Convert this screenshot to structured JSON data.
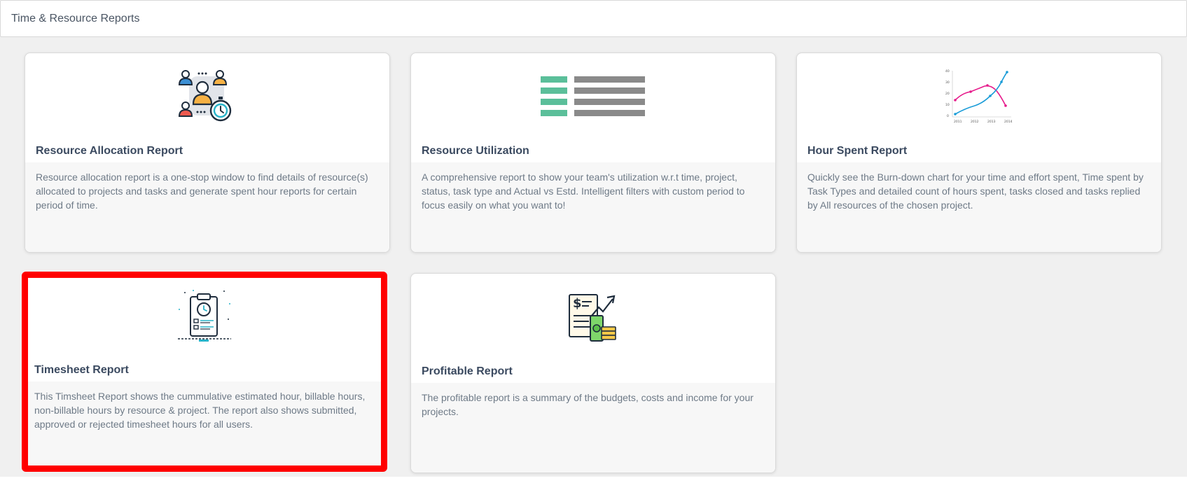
{
  "header": {
    "title": "Time & Resource Reports"
  },
  "colors": {
    "selection_border": "#ff0000",
    "background": "#f0f0f0"
  },
  "cards": [
    {
      "title": "Resource Allocation Report",
      "description": "Resource allocation report is a one-stop window to find details of resource(s) allocated to projects and tasks and generate spent hour reports for certain period of time.",
      "icon": "resource-allocation-icon"
    },
    {
      "title": "Resource Utilization",
      "description": "A comprehensive report to show your team's utilization w.r.t time, project, status, task type and Actual vs Estd. Intelligent filters with custom period to focus easily on what you want to!",
      "icon": "list-icon"
    },
    {
      "title": "Hour Spent Report",
      "description": "Quickly see the Burn-down chart for your time and effort spent, Time spent by Task Types and detailed count of hours spent, tasks closed and tasks replied by All resources of the chosen project.",
      "icon": "line-chart-icon",
      "icon_chart": {
        "y_ticks": [
          "40",
          "30",
          "20",
          "10",
          "0"
        ],
        "x_ticks": [
          "2011",
          "2012",
          "2013",
          "2014"
        ]
      }
    },
    {
      "title": "Timesheet Report",
      "description": "This Timsheet Report shows the cummulative estimated hour, billable hours, non-billable hours by resource & project. The report also shows submitted, approved or rejected timesheet hours for all users.",
      "icon": "timesheet-clipboard-icon",
      "selected": true
    },
    {
      "title": "Profitable Report",
      "description": "The profitable report is a summary of the budgets, costs and income for your projects.",
      "icon": "profit-document-icon"
    }
  ]
}
